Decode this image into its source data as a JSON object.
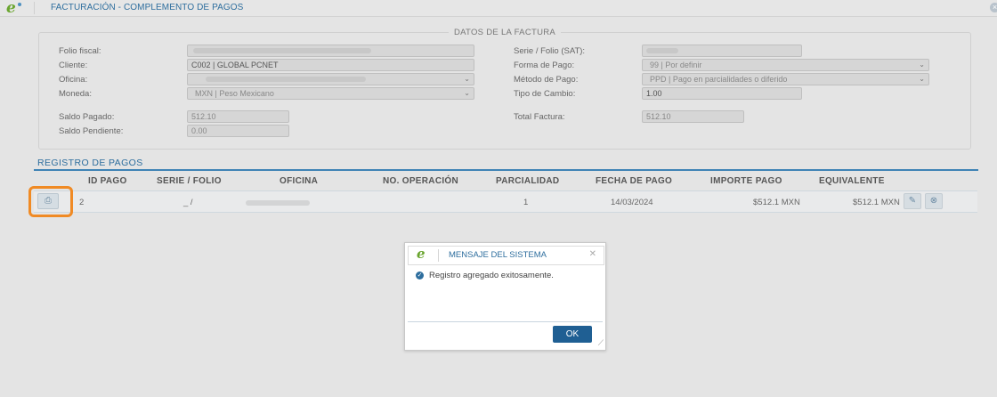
{
  "window": {
    "title": "FACTURACIÓN - COMPLEMENTO DE PAGOS",
    "logo_text": "e",
    "close_icon": "close-icon"
  },
  "datos": {
    "legend": "DATOS DE LA FACTURA",
    "folio_fiscal": {
      "label": "Folio fiscal:",
      "value": ""
    },
    "cliente": {
      "label": "Cliente:",
      "value": "C002 | GLOBAL PCNET"
    },
    "oficina": {
      "label": "Oficina:",
      "value": ""
    },
    "moneda": {
      "label": "Moneda:",
      "value": "MXN | Peso Mexicano"
    },
    "saldo_pagado": {
      "label": "Saldo Pagado:",
      "value": "512.10"
    },
    "saldo_pendiente": {
      "label": "Saldo Pendiente:",
      "value": "0.00"
    },
    "serie_folio": {
      "label": "Serie / Folio (SAT):",
      "value": ""
    },
    "forma_pago": {
      "label": "Forma de Pago:",
      "value": "99 | Por definir"
    },
    "metodo_pago": {
      "label": "Método de Pago:",
      "value": "PPD | Pago en parcialidades o diferido"
    },
    "tipo_cambio": {
      "label": "Tipo de Cambio:",
      "value": "1.00"
    },
    "total_factura": {
      "label": "Total Factura:",
      "value": "512.10"
    }
  },
  "registro": {
    "title": "REGISTRO DE PAGOS",
    "columns": [
      "ID PAGO",
      "SERIE / FOLIO",
      "OFICINA",
      "NO. OPERACIÓN",
      "PARCIALIDAD",
      "FECHA DE PAGO",
      "IMPORTE PAGO",
      "EQUIVALENTE"
    ],
    "rows": [
      {
        "id_pago": "2",
        "serie_folio": "_ /",
        "oficina": "",
        "no_operacion": "",
        "parcialidad": "1",
        "fecha_pago": "14/03/2024",
        "importe_pago": "$512.1 MXN",
        "equivalente": "$512.1 MXN"
      }
    ],
    "highlight_color": "#f08a24"
  },
  "modal": {
    "title": "MENSAJE DEL SISTEMA",
    "message": "Registro agregado exitosamente.",
    "ok_label": "OK"
  }
}
